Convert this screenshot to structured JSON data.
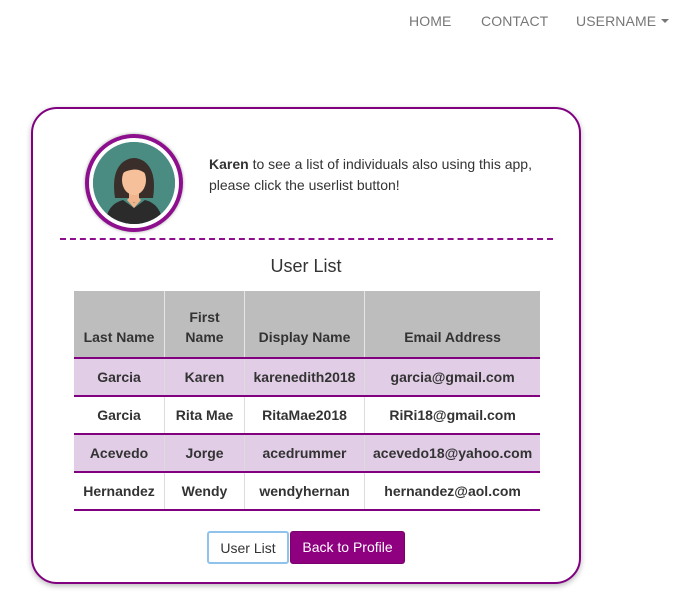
{
  "nav": {
    "items": [
      {
        "label": "HOME"
      },
      {
        "label": "CONTACT"
      },
      {
        "label": "USERNAME"
      }
    ]
  },
  "profile": {
    "name": "Karen",
    "intro_text": " to see a list of individuals also using this app, please click the userlist button!"
  },
  "user_list": {
    "title": "User List",
    "headers": [
      "Last Name",
      "First Name",
      "Display Name",
      "Email Address"
    ],
    "rows": [
      {
        "last": "Garcia",
        "first": "Karen",
        "display": "karenedith2018",
        "email": "garcia@gmail.com"
      },
      {
        "last": "Garcia",
        "first": "Rita Mae",
        "display": "RitaMae2018",
        "email": "RiRi18@gmail.com"
      },
      {
        "last": "Acevedo",
        "first": "Jorge",
        "display": "acedrummer",
        "email": "acevedo18@yahoo.com"
      },
      {
        "last": "Hernandez",
        "first": "Wendy",
        "display": "wendyhernan",
        "email": "hernandez@aol.com"
      }
    ]
  },
  "buttons": {
    "user_list": "User List",
    "back_to_profile": "Back to Profile"
  },
  "colors": {
    "accent": "#800080",
    "row_highlight": "#e1cde6",
    "header_bg": "#bdbdbd",
    "avatar_bg": "#4a8c82"
  },
  "icons": {
    "avatar": "female-avatar-icon",
    "dropdown": "caret-down-icon"
  }
}
